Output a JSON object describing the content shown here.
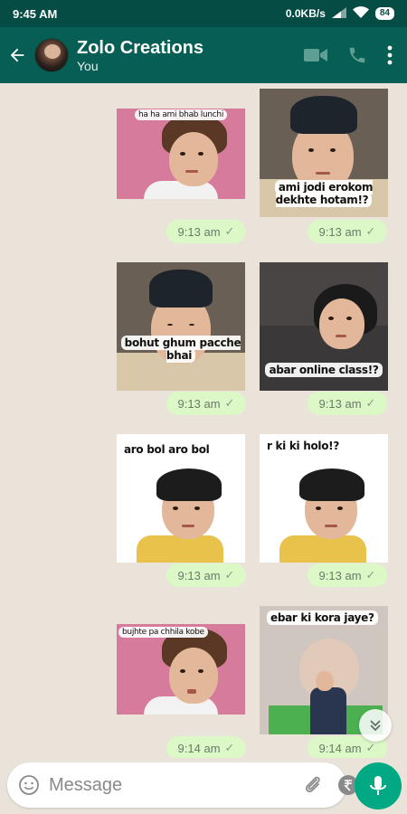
{
  "status_bar": {
    "time": "9:45 AM",
    "speed": "0.0KB/s",
    "battery": "84"
  },
  "header": {
    "title": "Zolo Creations",
    "subtitle": "You"
  },
  "messages": [
    {
      "caption": "ha ha ami bhab lunchi",
      "time": "9:13 am"
    },
    {
      "caption": "ami jodi erokom dekhte hotam!?",
      "time": "9:13 am"
    },
    {
      "caption": "bohut ghum pacche bhai",
      "time": "9:13 am"
    },
    {
      "caption": "abar online class!?",
      "time": "9:13 am"
    },
    {
      "caption": "aro bol aro bol",
      "time": "9:13 am"
    },
    {
      "caption": "r ki ki holo!?",
      "time": "9:13 am"
    },
    {
      "caption": "bujhte pa chhila kobe",
      "time": "9:14 am"
    },
    {
      "caption": "ebar ki kora jaye?",
      "time": "9:14 am"
    }
  ],
  "input": {
    "placeholder": "Message"
  },
  "icons": {
    "back": "arrow-left-icon",
    "video": "video-call-icon",
    "call": "phone-icon",
    "menu": "more-vertical-icon",
    "emoji": "emoji-icon",
    "attach": "paperclip-icon",
    "payment": "rupee-icon",
    "camera": "camera-icon",
    "mic": "mic-icon",
    "scroll": "double-chevron-down-icon"
  },
  "colors": {
    "header": "#075e54",
    "bubble": "#dcf8c6",
    "mic": "#00a884",
    "wallpaper": "#e9e3da"
  }
}
